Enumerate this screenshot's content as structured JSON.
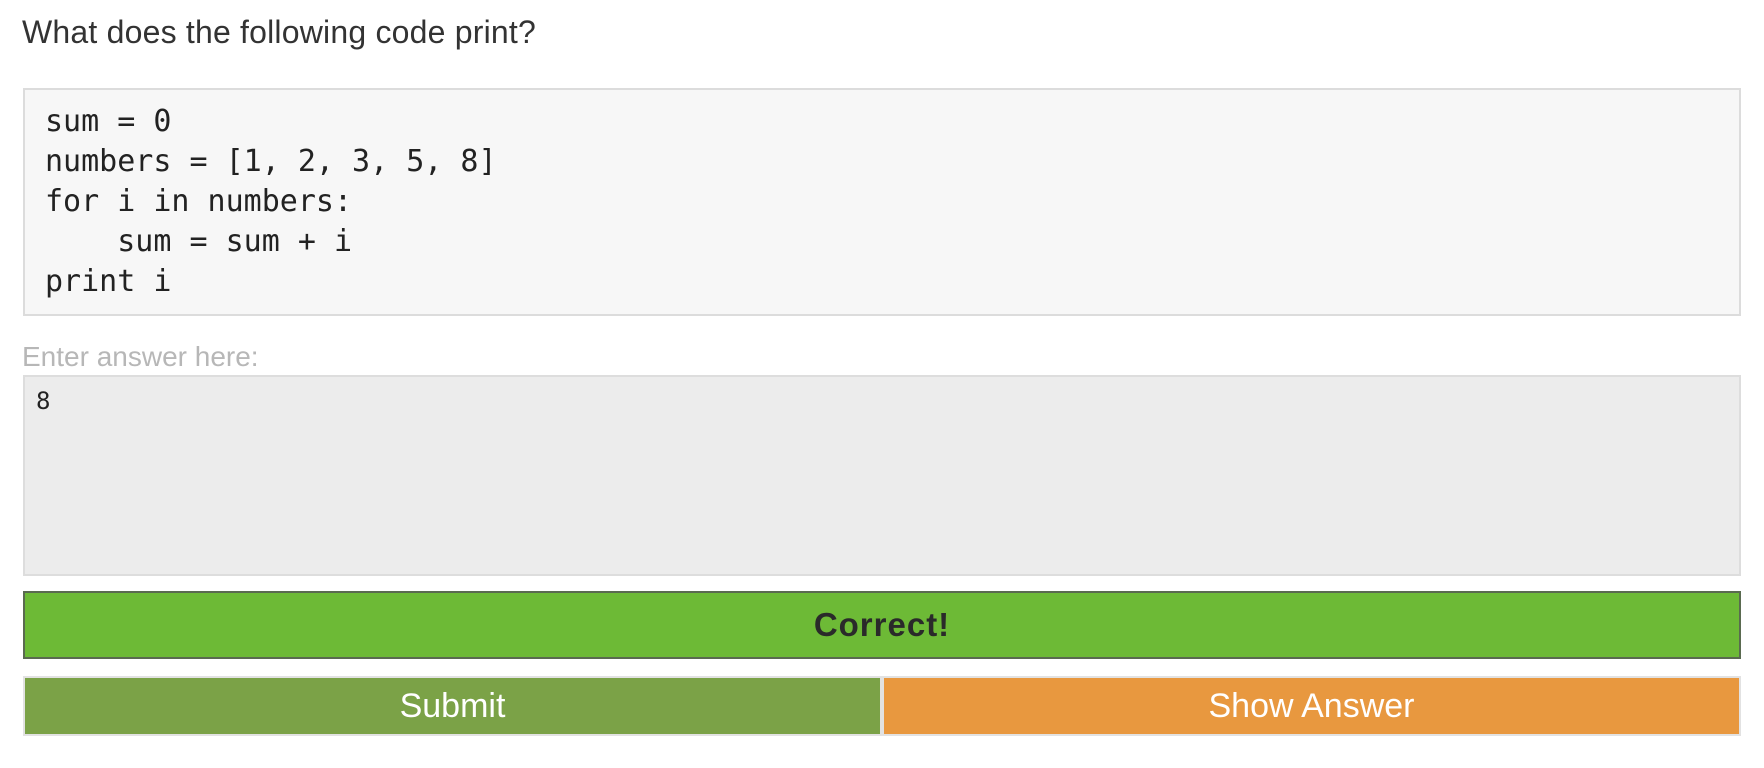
{
  "question": {
    "text": "What does the following code print?"
  },
  "code": {
    "text": "sum = 0\nnumbers = [1, 2, 3, 5, 8]\nfor i in numbers:\n    sum = sum + i\nprint i"
  },
  "answer": {
    "label": "Enter answer here:",
    "value": "8"
  },
  "feedback": {
    "text": "Correct!",
    "status": "correct",
    "color": "#6dba36"
  },
  "buttons": {
    "submit_label": "Submit",
    "submit_color": "#7ba247",
    "show_answer_label": "Show Answer",
    "show_answer_color": "#e8983f"
  }
}
